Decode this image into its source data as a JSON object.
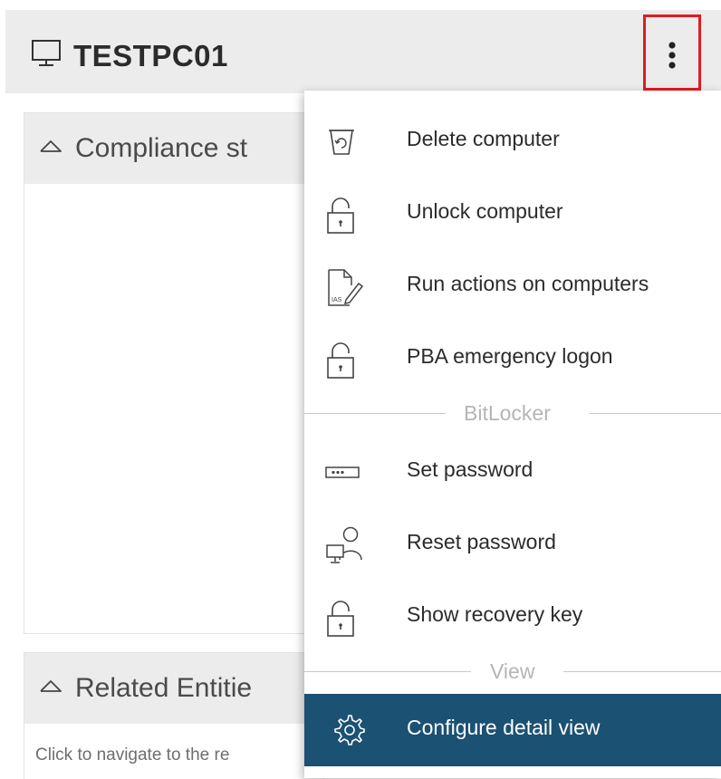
{
  "header": {
    "title": "TESTPC01",
    "icon": "monitor-icon",
    "more_icon": "kebab-menu-icon",
    "highlight_color": "#e11b22"
  },
  "panels": {
    "compliance": {
      "title": "Compliance st"
    },
    "related": {
      "title": "Related Entitie",
      "hint": "Click to navigate to the re"
    }
  },
  "menu": {
    "items": [
      {
        "label": "Delete computer",
        "icon": "trash-icon"
      },
      {
        "label": "Unlock computer",
        "icon": "unlock-icon"
      },
      {
        "label": "Run actions on computers",
        "icon": "script-edit-icon"
      },
      {
        "label": "PBA emergency logon",
        "icon": "unlock-icon"
      }
    ],
    "bitlocker_section": "BitLocker",
    "bitlocker_items": [
      {
        "label": "Set password",
        "icon": "password-field-icon"
      },
      {
        "label": "Reset password",
        "icon": "user-computer-icon"
      },
      {
        "label": "Show recovery key",
        "icon": "unlock-icon"
      }
    ],
    "view_section": "View",
    "view_items": [
      {
        "label": "Configure detail view",
        "icon": "gear-icon",
        "active": true
      }
    ],
    "active_color": "#1b5173"
  }
}
